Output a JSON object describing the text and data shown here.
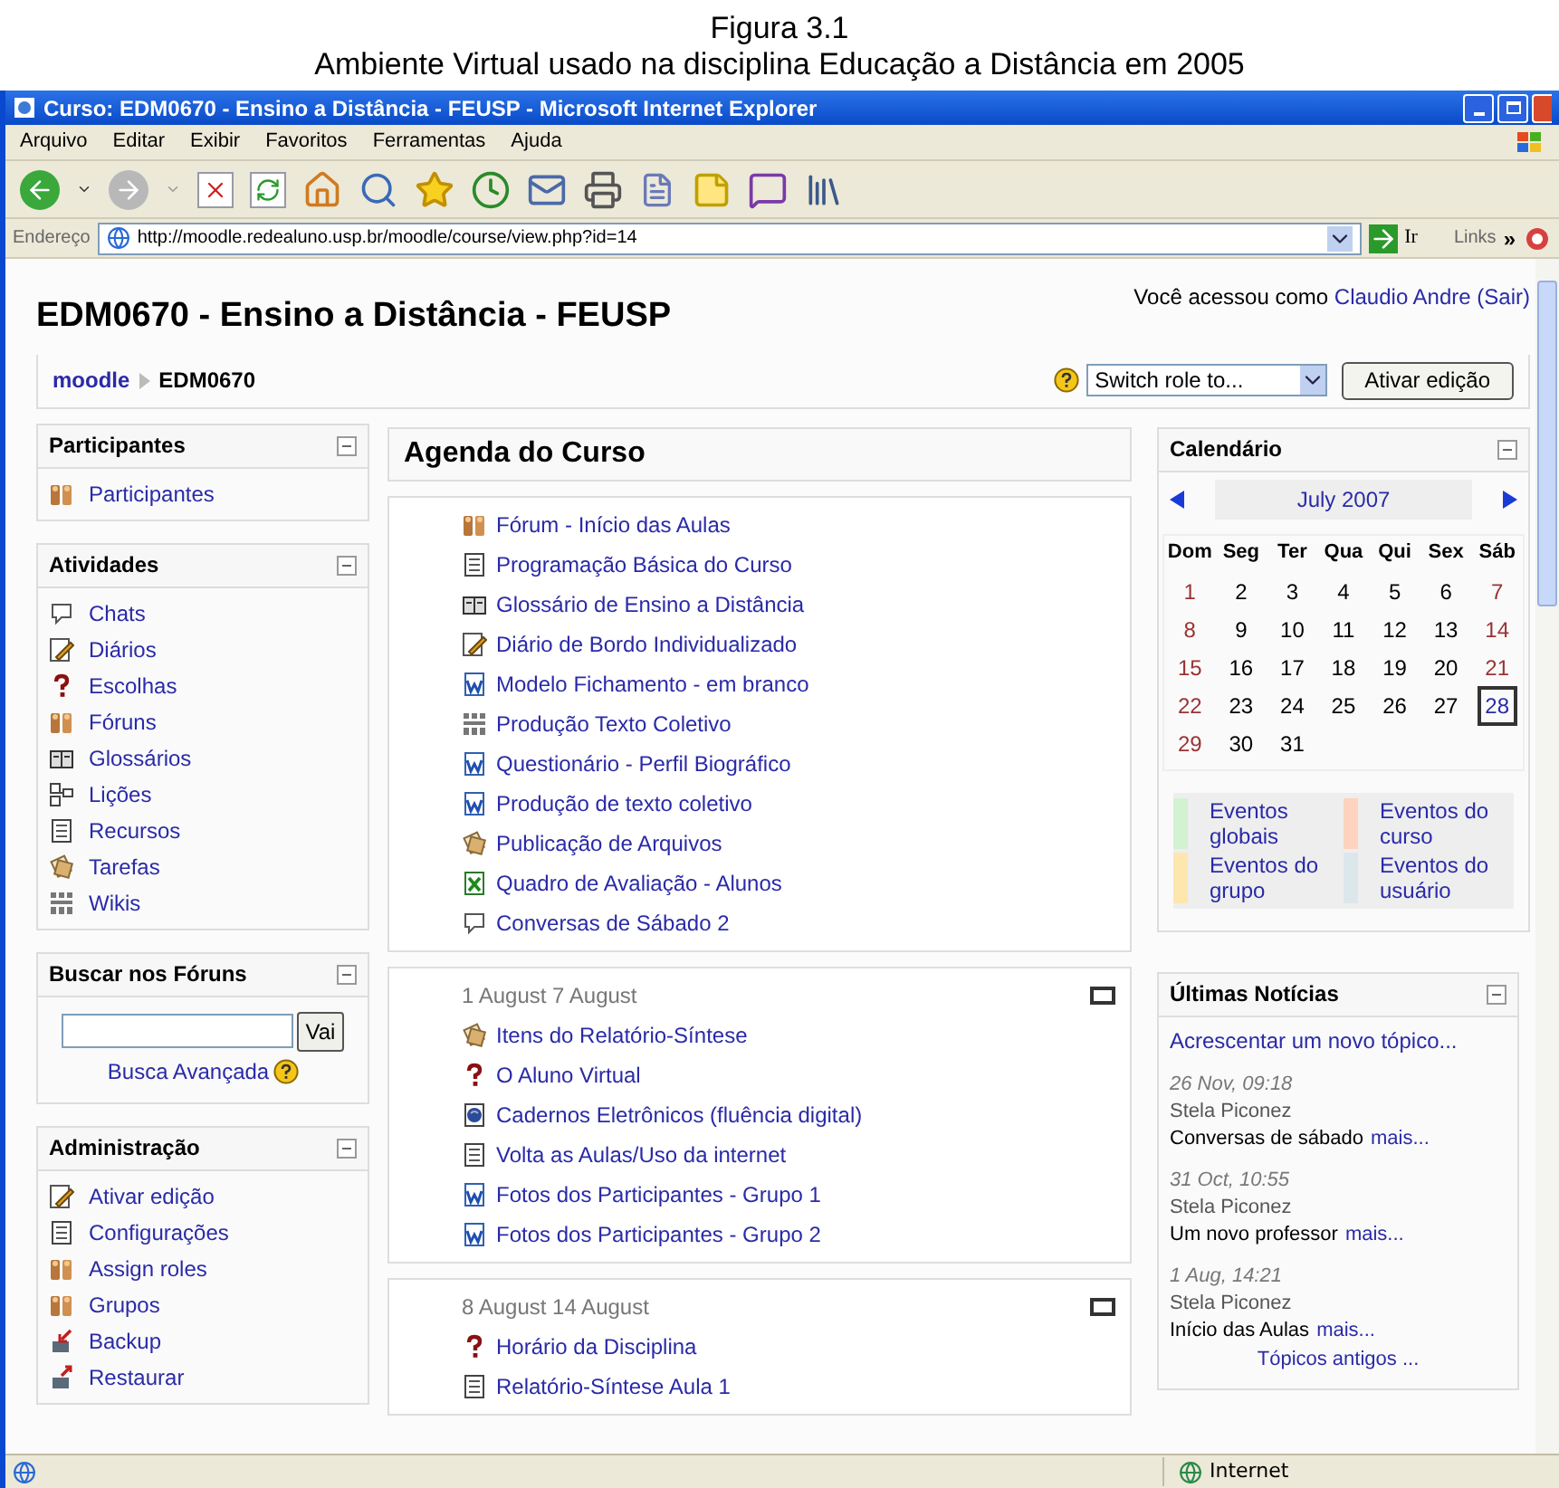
{
  "caption": {
    "figure": "Figura 3.1",
    "title": "Ambiente Virtual usado na disciplina Educação a Distância em 2005"
  },
  "window": {
    "title": "Curso: EDM0670 - Ensino a Distância - FEUSP - Microsoft Internet Explorer"
  },
  "menu": [
    "Arquivo",
    "Editar",
    "Exibir",
    "Favoritos",
    "Ferramentas",
    "Ajuda"
  ],
  "address": {
    "label": "Endereço",
    "url": "http://moodle.redealuno.usp.br/moodle/course/view.php?id=14",
    "go": "Ir",
    "links": "Links",
    "more": "»"
  },
  "page": {
    "title": "EDM0670 - Ensino a Distância - FEUSP",
    "login_prefix": "Você acessou como",
    "user": "Claudio Andre",
    "logout": "(Sair)",
    "breadcrumb": [
      "moodle",
      "EDM0670"
    ],
    "role_select": "Switch role to...",
    "edit_button": "Ativar edição"
  },
  "left_blocks": [
    {
      "kind": "list",
      "title": "Participantes",
      "items": [
        {
          "kind": "forum",
          "label": "Participantes"
        }
      ]
    },
    {
      "kind": "list",
      "title": "Atividades",
      "items": [
        {
          "kind": "chat",
          "label": "Chats"
        },
        {
          "kind": "journal",
          "label": "Diários"
        },
        {
          "kind": "choice",
          "label": "Escolhas"
        },
        {
          "kind": "forum",
          "label": "Fóruns"
        },
        {
          "kind": "glossary",
          "label": "Glossários"
        },
        {
          "kind": "lesson",
          "label": "Lições"
        },
        {
          "kind": "resource",
          "label": "Recursos"
        },
        {
          "kind": "assignment",
          "label": "Tarefas"
        },
        {
          "kind": "wiki",
          "label": "Wikis"
        }
      ]
    },
    {
      "kind": "search",
      "title": "Buscar nos Fóruns",
      "button": "Vai",
      "link": "Busca Avançada"
    },
    {
      "kind": "list",
      "title": "Administração",
      "items": [
        {
          "kind": "edit",
          "label": "Ativar edição"
        },
        {
          "kind": "settings",
          "label": "Configurações"
        },
        {
          "kind": "roles",
          "label": "Assign roles"
        },
        {
          "kind": "groups",
          "label": "Grupos"
        },
        {
          "kind": "backup",
          "label": "Backup"
        },
        {
          "kind": "restore",
          "label": "Restaurar"
        }
      ]
    }
  ],
  "agenda_title": "Agenda do Curso",
  "sections": [
    {
      "items": [
        {
          "kind": "forum",
          "label": "Fórum - Início das Aulas"
        },
        {
          "kind": "resource",
          "label": "Programação Básica do Curso"
        },
        {
          "kind": "glossary",
          "label": "Glossário de Ensino a Distância"
        },
        {
          "kind": "journal",
          "label": "Diário de Bordo Individualizado"
        },
        {
          "kind": "word",
          "label": "Modelo Fichamento - em branco"
        },
        {
          "kind": "wiki",
          "label": "Produção Texto Coletivo"
        },
        {
          "kind": "word",
          "label": "Questionário - Perfil Biográfico"
        },
        {
          "kind": "word",
          "label": "Produção de texto coletivo"
        },
        {
          "kind": "assignment",
          "label": "Publicação de Arquivos"
        },
        {
          "kind": "excel",
          "label": "Quadro de Avaliação - Alunos"
        },
        {
          "kind": "chat",
          "label": "Conversas de Sábado 2"
        }
      ]
    },
    {
      "dates": "1 August 7 August",
      "items": [
        {
          "kind": "assignment",
          "label": "Itens do Relatório-Síntese"
        },
        {
          "kind": "choice",
          "label": "O Aluno Virtual"
        },
        {
          "kind": "web",
          "label": "Cadernos Eletrônicos (fluência digital)"
        },
        {
          "kind": "resource",
          "label": "Volta as Aulas/Uso da internet"
        },
        {
          "kind": "word",
          "label": "Fotos dos Participantes - Grupo 1"
        },
        {
          "kind": "word",
          "label": "Fotos dos Participantes - Grupo 2"
        }
      ]
    },
    {
      "dates": "8 August 14 August",
      "items": [
        {
          "kind": "choice",
          "label": "Horário da Disciplina"
        },
        {
          "kind": "resource",
          "label": "Relatório-Síntese Aula 1"
        }
      ]
    }
  ],
  "calendar": {
    "title": "Calendário",
    "month": "July 2007",
    "weekdays": [
      "Dom",
      "Seg",
      "Ter",
      "Qua",
      "Qui",
      "Sex",
      "Sáb"
    ],
    "weeks": [
      [
        {
          "day": "1",
          "today": false
        },
        {
          "day": "2",
          "today": false
        },
        {
          "day": "3",
          "today": false
        },
        {
          "day": "4",
          "today": false
        },
        {
          "day": "5",
          "today": false
        },
        {
          "day": "6",
          "today": false
        },
        {
          "day": "7",
          "today": false
        }
      ],
      [
        {
          "day": "8",
          "today": false
        },
        {
          "day": "9",
          "today": false
        },
        {
          "day": "10",
          "today": false
        },
        {
          "day": "11",
          "today": false
        },
        {
          "day": "12",
          "today": false
        },
        {
          "day": "13",
          "today": false
        },
        {
          "day": "14",
          "today": false
        }
      ],
      [
        {
          "day": "15",
          "today": false
        },
        {
          "day": "16",
          "today": false
        },
        {
          "day": "17",
          "today": false
        },
        {
          "day": "18",
          "today": false
        },
        {
          "day": "19",
          "today": false
        },
        {
          "day": "20",
          "today": false
        },
        {
          "day": "21",
          "today": false
        }
      ],
      [
        {
          "day": "22",
          "today": false
        },
        {
          "day": "23",
          "today": false
        },
        {
          "day": "24",
          "today": false
        },
        {
          "day": "25",
          "today": false
        },
        {
          "day": "26",
          "today": false
        },
        {
          "day": "27",
          "today": false
        },
        {
          "day": "28",
          "today": true
        }
      ],
      [
        {
          "day": "29",
          "today": false
        },
        {
          "day": "30",
          "today": false
        },
        {
          "day": "31",
          "today": false
        }
      ]
    ],
    "legend": [
      {
        "label": "Eventos globais",
        "color": "#d2f2d2"
      },
      {
        "label": "Eventos do curso",
        "color": "#ffd3bd"
      },
      {
        "label": "Eventos do grupo",
        "color": "#fee7ae"
      },
      {
        "label": "Eventos do usuário",
        "color": "#dce7ec"
      }
    ]
  },
  "news": {
    "title": "Últimas Notícias",
    "add": "Acrescentar um novo tópico...",
    "posts": [
      {
        "date": "26 Nov, 09:18",
        "author": "Stela Piconez",
        "subject": "Conversas de sábado",
        "more": "mais..."
      },
      {
        "date": "31 Oct, 10:55",
        "author": "Stela Piconez",
        "subject": "Um novo professor",
        "more": "mais..."
      },
      {
        "date": "1 Aug, 14:21",
        "author": "Stela Piconez",
        "subject": "Início das Aulas",
        "more": "mais..."
      }
    ],
    "older": "Tópicos antigos ..."
  },
  "status": {
    "zone": "Internet"
  }
}
